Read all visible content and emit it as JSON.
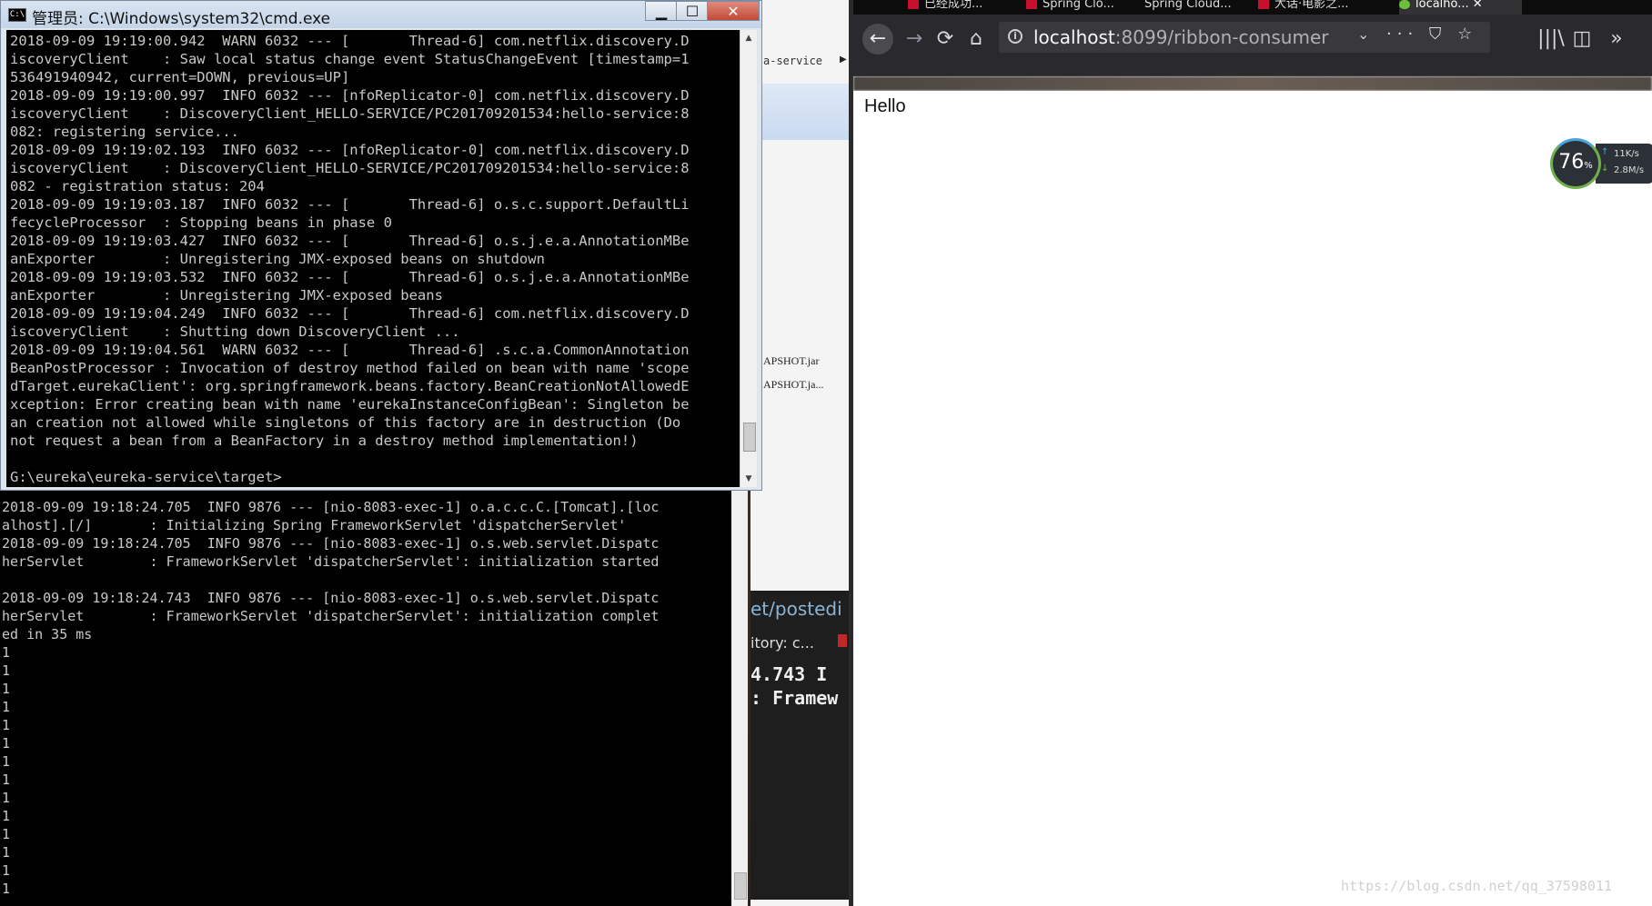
{
  "cmd_window": {
    "title": "管理员: C:\\Windows\\system32\\cmd.exe",
    "icon_text": "C:\\",
    "minimize_label": "▁",
    "maximize_label": "☐",
    "close_label": "✕",
    "lines": [
      "2018-09-09 19:19:00.942  WARN 6032 --- [       Thread-6] com.netflix.discovery.D",
      "iscoveryClient    : Saw local status change event StatusChangeEvent [timestamp=1",
      "536491940942, current=DOWN, previous=UP]",
      "2018-09-09 19:19:00.997  INFO 6032 --- [nfoReplicator-0] com.netflix.discovery.D",
      "iscoveryClient    : DiscoveryClient_HELLO-SERVICE/PC201709201534:hello-service:8",
      "082: registering service...",
      "2018-09-09 19:19:02.193  INFO 6032 --- [nfoReplicator-0] com.netflix.discovery.D",
      "iscoveryClient    : DiscoveryClient_HELLO-SERVICE/PC201709201534:hello-service:8",
      "082 - registration status: 204",
      "2018-09-09 19:19:03.187  INFO 6032 --- [       Thread-6] o.s.c.support.DefaultLi",
      "fecycleProcessor  : Stopping beans in phase 0",
      "2018-09-09 19:19:03.427  INFO 6032 --- [       Thread-6] o.s.j.e.a.AnnotationMBe",
      "anExporter        : Unregistering JMX-exposed beans on shutdown",
      "2018-09-09 19:19:03.532  INFO 6032 --- [       Thread-6] o.s.j.e.a.AnnotationMBe",
      "anExporter        : Unregistering JMX-exposed beans",
      "2018-09-09 19:19:04.249  INFO 6032 --- [       Thread-6] com.netflix.discovery.D",
      "iscoveryClient    : Shutting down DiscoveryClient ...",
      "2018-09-09 19:19:04.561  WARN 6032 --- [       Thread-6] .s.c.a.CommonAnnotation",
      "BeanPostProcessor : Invocation of destroy method failed on bean with name 'scope",
      "dTarget.eurekaClient': org.springframework.beans.factory.BeanCreationNotAllowedE",
      "xception: Error creating bean with name 'eurekaInstanceConfigBean': Singleton be",
      "an creation not allowed while singletons of this factory are in destruction (Do",
      "not request a bean from a BeanFactory in a destroy method implementation!)",
      "",
      "G:\\eureka\\eureka-service\\target>"
    ]
  },
  "console2": {
    "lines": [
      "2018-09-09 19:18:24.705  INFO 9876 --- [nio-8083-exec-1] o.a.c.c.C.[Tomcat].[loc",
      "alhost].[/]       : Initializing Spring FrameworkServlet 'dispatcherServlet'",
      "2018-09-09 19:18:24.705  INFO 9876 --- [nio-8083-exec-1] o.s.web.servlet.Dispatc",
      "herServlet        : FrameworkServlet 'dispatcherServlet': initialization started",
      "",
      "2018-09-09 19:18:24.743  INFO 9876 --- [nio-8083-exec-1] o.s.web.servlet.Dispatc",
      "herServlet        : FrameworkServlet 'dispatcherServlet': initialization complet",
      "ed in 35 ms",
      "1",
      "1",
      "1",
      "1",
      "1",
      "1",
      "1",
      "1",
      "1",
      "1",
      "1",
      "1",
      "1",
      "1"
    ]
  },
  "background": {
    "service_label": "a-service",
    "service_arrow": "▶",
    "jar1": "APSHOT.jar",
    "jar2": "APSHOT.ja...",
    "posted": "et/postedi",
    "repo": "itory: c...",
    "clip1": "4.743  I",
    "clip2": ": Framew"
  },
  "browser": {
    "tabs": [
      "已经成功...",
      "Spring Clo...",
      "Spring Cloud...",
      "大话·电影之...",
      "localho..."
    ],
    "tab_close": "✕",
    "url_host": "localhost",
    "url_rest": ":8099/ribbon-consumer",
    "info_icon": "i",
    "dropdown": "⌄",
    "page_actions": "··· ⛉ ☆",
    "back_icon": "←",
    "forward_icon": "→",
    "reload_icon": "⟳",
    "home_icon": "⌂",
    "library_icon": "|||\\",
    "sidebar_icon": "◫",
    "overflow_icon": "»",
    "page_text": "Hello"
  },
  "net_widget": {
    "percent": "76",
    "percent_sign": "%",
    "upload": "11K/s",
    "download": "2.8M/s",
    "up_arrow": "↑",
    "down_arrow": "↓"
  },
  "watermark": "https://blog.csdn.net/qq_37598011"
}
